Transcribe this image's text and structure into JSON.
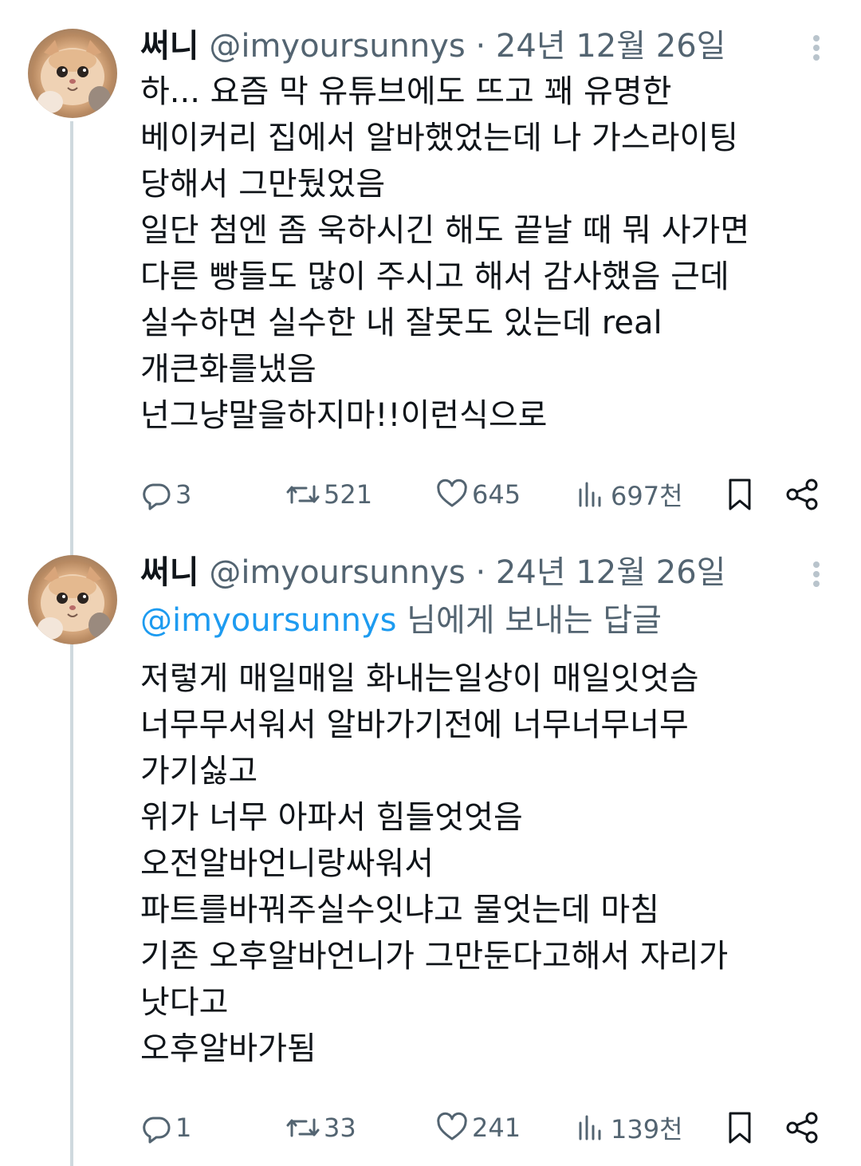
{
  "tweets": [
    {
      "name": "써니",
      "handle": "@imyoursunnys",
      "separator": "·",
      "date": "24년 12월 26일",
      "reply_prefix": "",
      "reply_mention": "",
      "reply_suffix": "",
      "lines": [
        "하... 요즘 막 유튜브에도 뜨고 꽤 유명한",
        "베이커리 집에서 알바했었는데 나 가스라이팅",
        "당해서 그만뒀었음",
        "일단 첨엔 좀 욱하시긴 해도 끝날 때 뭐 사가면",
        "다른 빵들도 많이 주시고 해서 감사했음 근데",
        "실수하면 실수한 내 잘못도 있는데 real",
        "개큰화를냈음",
        "넌그냥말을하지마!!이런식으로"
      ],
      "stats": {
        "replies": "3",
        "retweets": "521",
        "likes": "645",
        "views": "697천"
      }
    },
    {
      "name": "써니",
      "handle": "@imyoursunnys",
      "separator": "·",
      "date": "24년 12월 26일",
      "reply_prefix": "",
      "reply_mention": "@imyoursunnys",
      "reply_suffix": " 님에게 보내는 답글",
      "lines": [
        "저렇게 매일매일 화내는일상이 매일잇엇슴",
        "너무무서워서 알바가기전에 너무너무너무",
        "가기싫고",
        "위가 너무 아파서 힘들엇엇음",
        "오전알바언니랑싸워서",
        "파트를바꿔주실수잇냐고 물엇는데 마침",
        "기존 오후알바언니가 그만둔다고해서 자리가",
        "낫다고",
        "오후알바가됨"
      ],
      "stats": {
        "replies": "1",
        "retweets": "33",
        "likes": "241",
        "views": "139천"
      }
    }
  ],
  "icons": {
    "more": "more-vertical-icon",
    "reply": "reply-bubble-icon",
    "retweet": "retweet-icon",
    "like": "heart-icon",
    "views": "views-bar-chart-icon",
    "bookmark": "bookmark-icon",
    "share": "share-icon"
  },
  "colors": {
    "text": "#0f1419",
    "secondary": "#536471",
    "link": "#1d9bf0",
    "thread_line": "#cfd9de"
  }
}
